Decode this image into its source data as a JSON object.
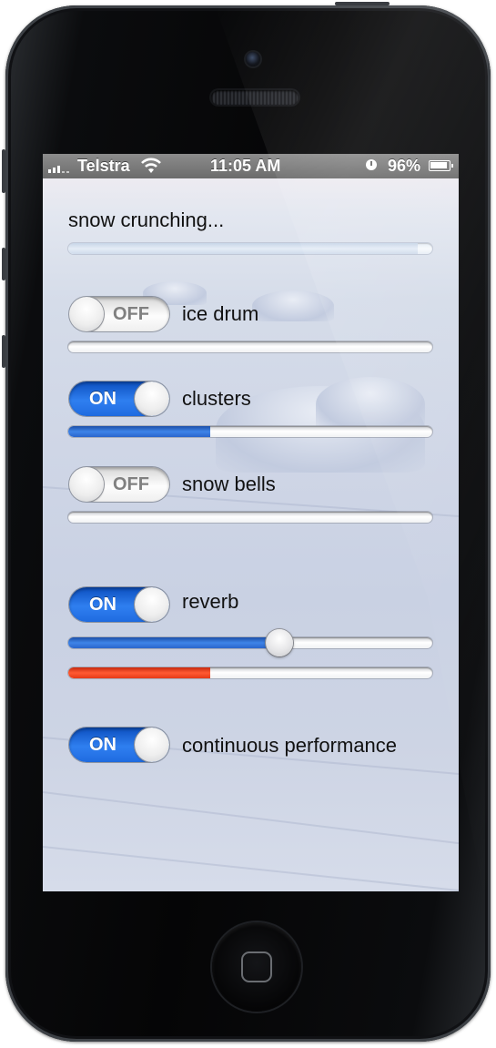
{
  "status_bar": {
    "carrier": "Telstra",
    "time": "11:05 AM",
    "battery": "96%",
    "signal_icon": "signal-bars",
    "wifi_icon": "wifi",
    "alarm_icon": "alarm-clock"
  },
  "colors": {
    "switch_on": "#2f7ff0",
    "progress_blue": "#3e84e8",
    "progress_red": "#ff5a32"
  },
  "header": {
    "title": "snow crunching...",
    "progress": 0.96
  },
  "rows": [
    {
      "label": "ice drum",
      "switch_text": "OFF",
      "on": false,
      "level": 0.0
    },
    {
      "label": "clusters",
      "switch_text": "ON",
      "on": true,
      "level": 0.39
    },
    {
      "label": "snow bells",
      "switch_text": "OFF",
      "on": false,
      "level": 0.0
    }
  ],
  "reverb": {
    "label": "reverb",
    "switch_text": "ON",
    "on": true,
    "slider_value": 0.58,
    "meter_level": 0.39
  },
  "continuous": {
    "label": "continuous performance",
    "switch_text": "ON",
    "on": true
  },
  "hardware": {
    "home_icon": "home-button-square"
  }
}
